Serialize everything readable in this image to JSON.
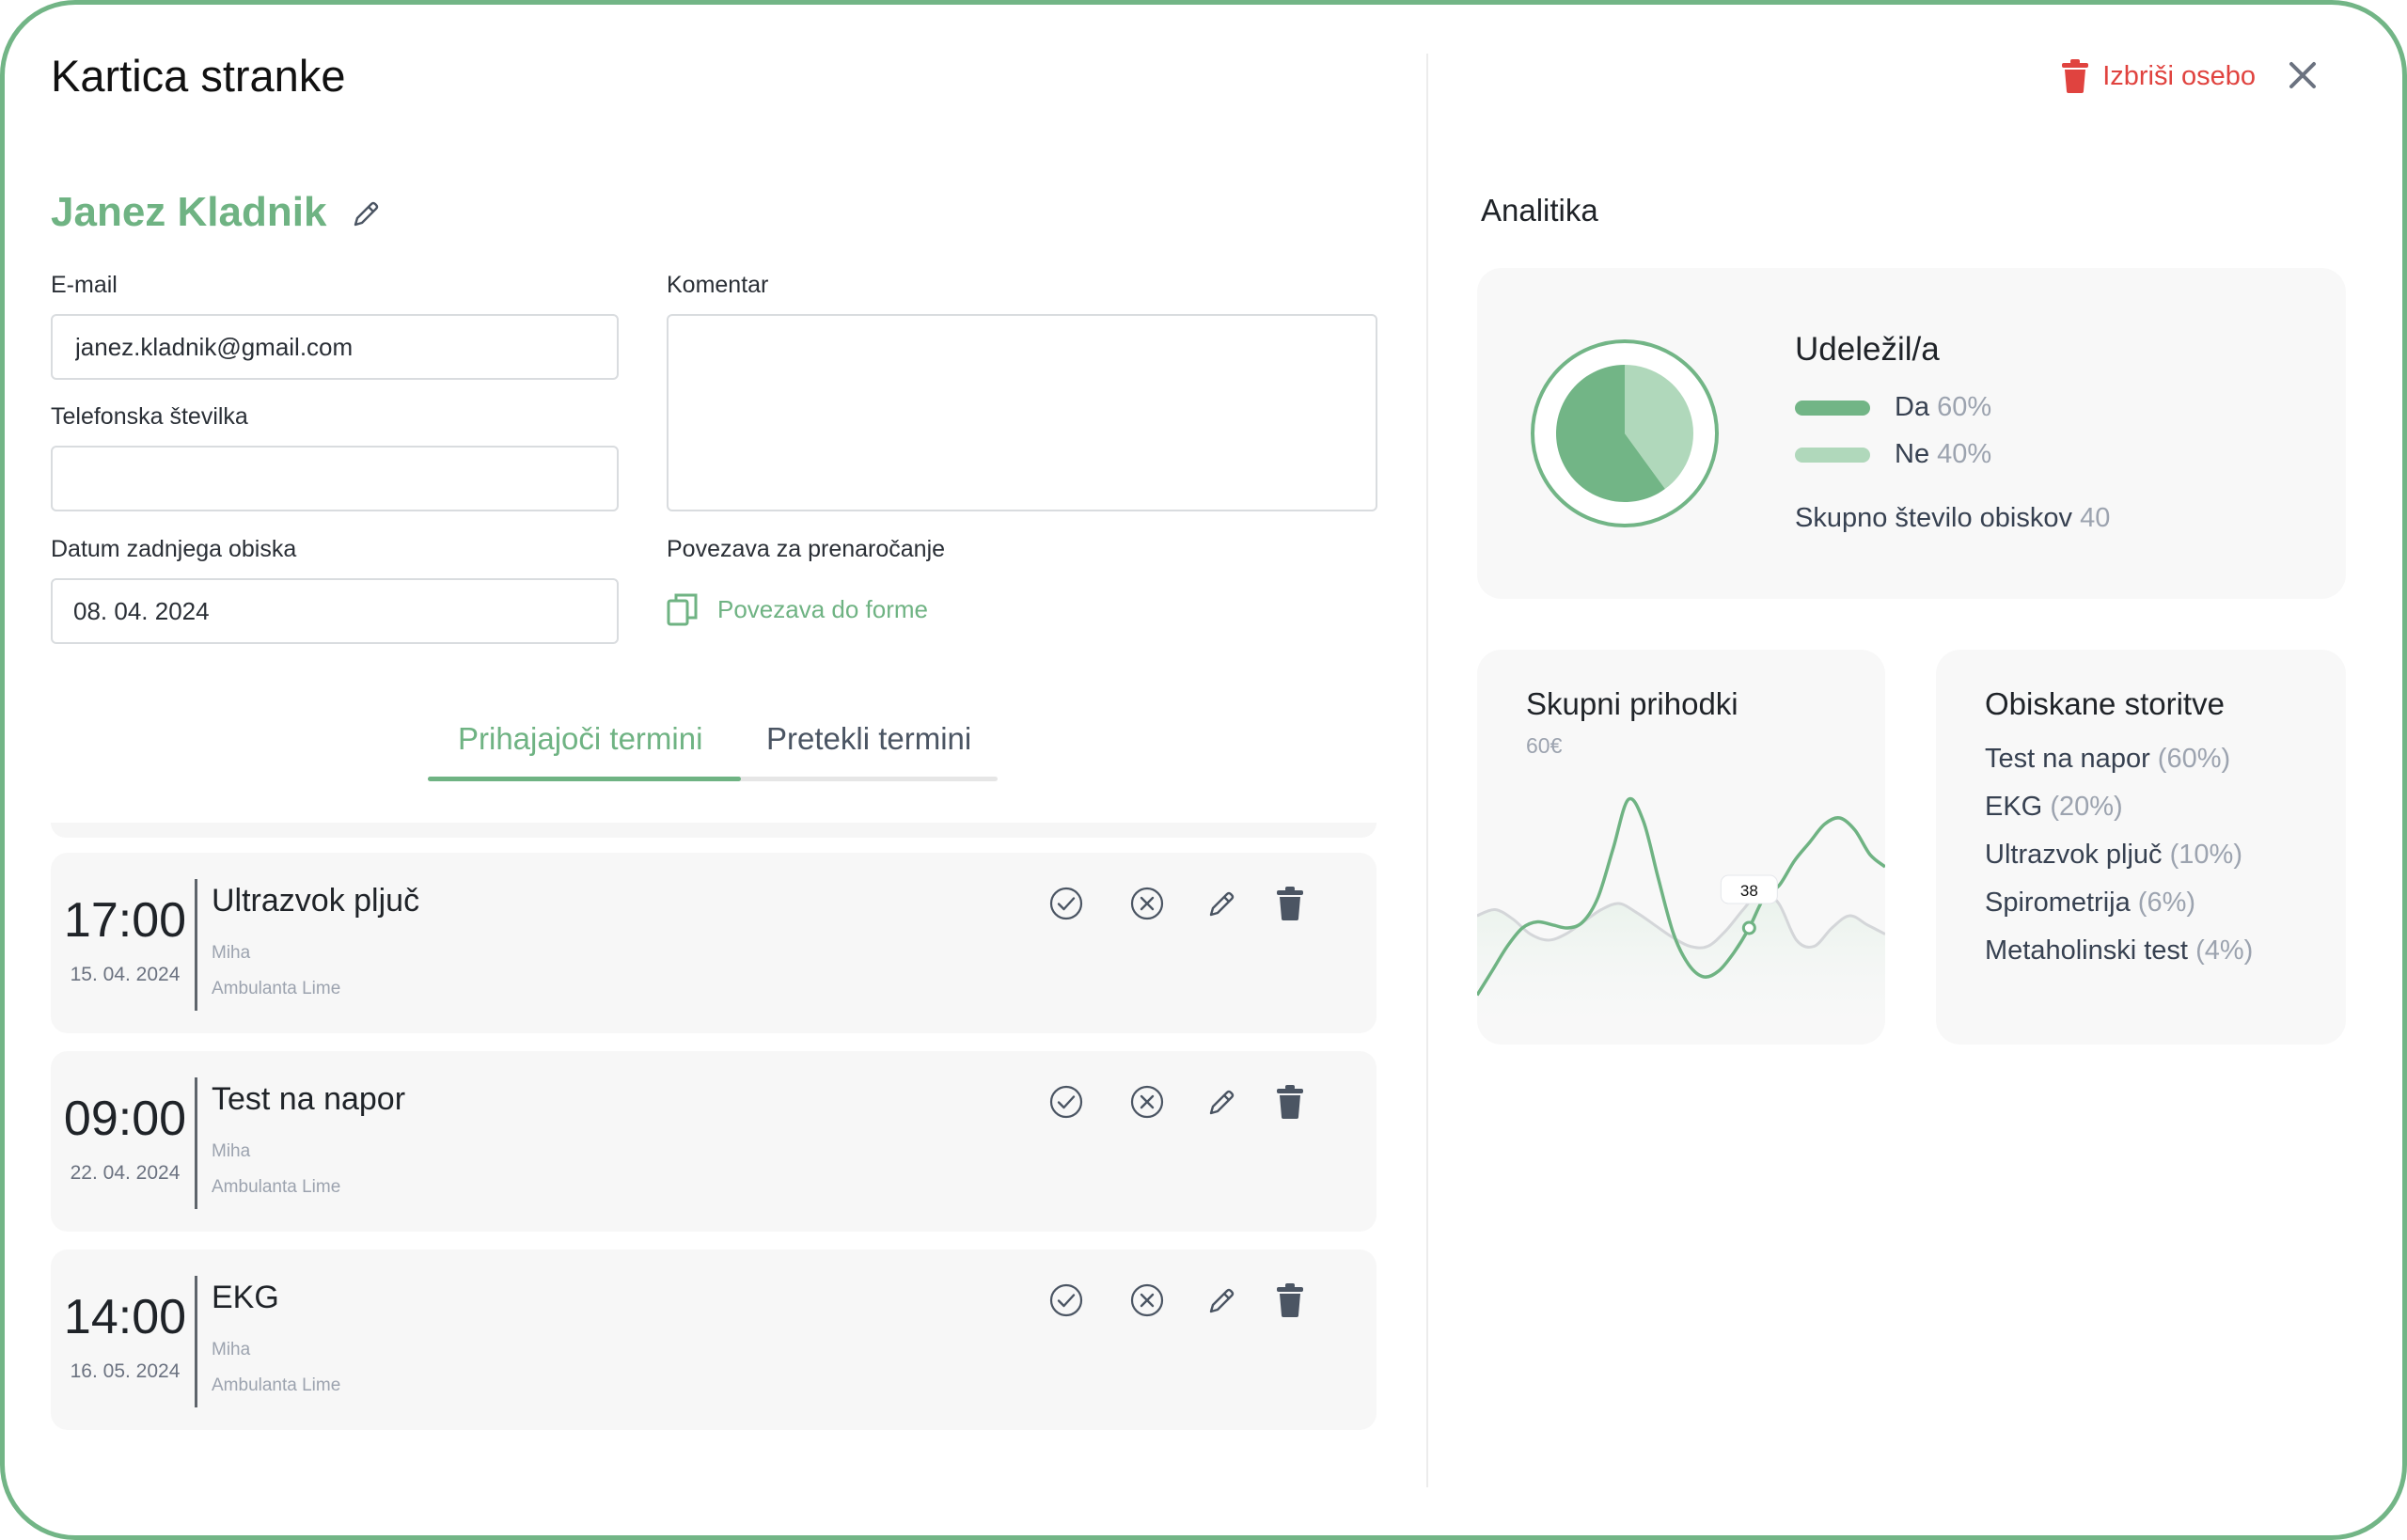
{
  "header": {
    "title": "Kartica stranke",
    "delete_label": "Izbriši osebo"
  },
  "client": {
    "name": "Janez Kladnik",
    "email_label": "E-mail",
    "email_value": "janez.kladnik@gmail.com",
    "phone_label": "Telefonska številka",
    "phone_value": "",
    "last_visit_label": "Datum zadnjega obiska",
    "last_visit_value": "08. 04. 2024",
    "comment_label": "Komentar",
    "comment_value": "",
    "rebook_label": "Povezava za prenaročanje",
    "rebook_link": "Povezava do forme"
  },
  "tabs": {
    "upcoming": "Prihajajoči termini",
    "past": "Pretekli termini",
    "active": "upcoming"
  },
  "appointments": [
    {
      "time": "17:00",
      "date": "15. 04. 2024",
      "service": "Ultrazvok pljuč",
      "doctor": "Miha",
      "location": "Ambulanta Lime"
    },
    {
      "time": "09:00",
      "date": "22. 04. 2024",
      "service": "Test na napor",
      "doctor": "Miha",
      "location": "Ambulanta Lime"
    },
    {
      "time": "14:00",
      "date": "16. 05. 2024",
      "service": "EKG",
      "doctor": "Miha",
      "location": "Ambulanta Lime"
    }
  ],
  "analytics": {
    "title": "Analitika",
    "attendance": {
      "title": "Udeležil/a",
      "yes_label": "Da",
      "yes_pct": "60%",
      "no_label": "Ne",
      "no_pct": "40%",
      "total_label": "Skupno število obiskov",
      "total_value": "40"
    },
    "revenue": {
      "title": "Skupni prihodki",
      "value": "60€",
      "tooltip": "38"
    },
    "services": {
      "title": "Obiskane storitve",
      "items": [
        {
          "name": "Test na napor",
          "pct": "(60%)"
        },
        {
          "name": "EKG",
          "pct": "(20%)"
        },
        {
          "name": "Ultrazvok pljuč",
          "pct": "(10%)"
        },
        {
          "name": "Spirometrija",
          "pct": "(6%)"
        },
        {
          "name": "Metaholinski test",
          "pct": "(4%)"
        }
      ]
    }
  },
  "chart_data": [
    {
      "type": "pie",
      "categories": [
        "Da",
        "Ne"
      ],
      "values": [
        60,
        40
      ],
      "colors": [
        "#72b586",
        "#b0d8bb"
      ]
    },
    {
      "type": "line",
      "x": [
        0,
        1,
        2,
        3,
        4,
        5,
        6,
        7,
        8,
        9,
        10,
        11,
        12,
        13,
        14,
        15,
        16,
        17,
        18,
        19,
        20,
        21,
        22,
        23,
        24,
        25,
        26,
        27,
        28,
        29,
        30,
        31,
        32,
        33,
        34,
        35,
        36,
        37,
        38,
        39,
        40
      ],
      "series": [
        {
          "values": [
            10,
            18,
            26,
            32,
            34,
            33,
            32,
            34,
            42,
            58,
            74,
            67,
            48,
            30,
            20,
            16,
            18,
            24,
            32,
            42,
            46,
            54,
            60,
            66,
            68,
            64,
            56,
            52
          ],
          "color": "#6fb383"
        },
        {
          "values": [
            36,
            38,
            35,
            30,
            28,
            30,
            34,
            38,
            40,
            37,
            33,
            29,
            26,
            26,
            31,
            38,
            44,
            40,
            28,
            26,
            32,
            36,
            33,
            30
          ],
          "color": "#d4d6d9"
        }
      ],
      "highlight": {
        "label": "38"
      }
    }
  ],
  "colors": {
    "accent": "#6fb383",
    "danger": "#e0433f",
    "pie_yes": "#72b586",
    "pie_no": "#b0d8bb"
  },
  "icons": [
    "trash-icon",
    "close-icon",
    "pencil-icon",
    "copy-icon",
    "check-circle-icon",
    "x-circle-icon"
  ]
}
